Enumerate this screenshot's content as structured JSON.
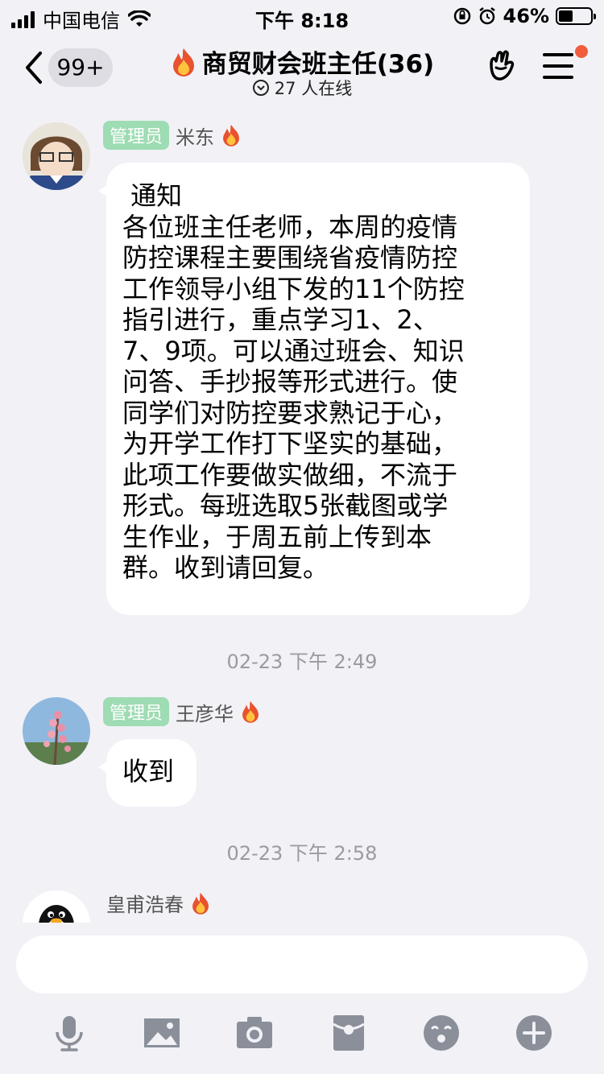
{
  "status_bar": {
    "carrier": "中国电信",
    "time": "下午 8:18",
    "battery": "46%",
    "battery_level": 0.46
  },
  "header": {
    "unread_badge": "99+",
    "group_title": "商贸财会班主任(36)",
    "online_text": "27 人在线"
  },
  "messages": [
    {
      "role_tag": "管理员",
      "sender": "米东",
      "lines": [
        " 通知",
        "各位班主任老师，本周的疫情",
        "防控课程主要围绕省疫情防控",
        "工作领导小组下发的11个防控",
        "指引进行，重点学习1、2、",
        "7、9项。可以通过班会、知识",
        "问答、手抄报等形式进行。使",
        "同学们对防控要求熟记于心，",
        "为开学工作打下坚实的基础，",
        "此项工作要做实做细，不流于",
        "形式。每班选取5张截图或学",
        "生作业，于周五前上传到本",
        "群。收到请回复。"
      ]
    },
    {
      "timestamp": "02-23 下午 2:49",
      "role_tag": "管理员",
      "sender": "王彦华",
      "text": "收到"
    },
    {
      "timestamp": "02-23 下午 2:58",
      "sender": "皇甫浩春"
    }
  ],
  "composer": {
    "placeholder": ""
  },
  "icons": [
    "back-icon",
    "fire-icon",
    "online-chevron-icon",
    "hand-icon",
    "menu-icon",
    "mic-icon",
    "image-icon",
    "camera-icon",
    "red-packet-icon",
    "emoji-icon",
    "plus-icon"
  ]
}
